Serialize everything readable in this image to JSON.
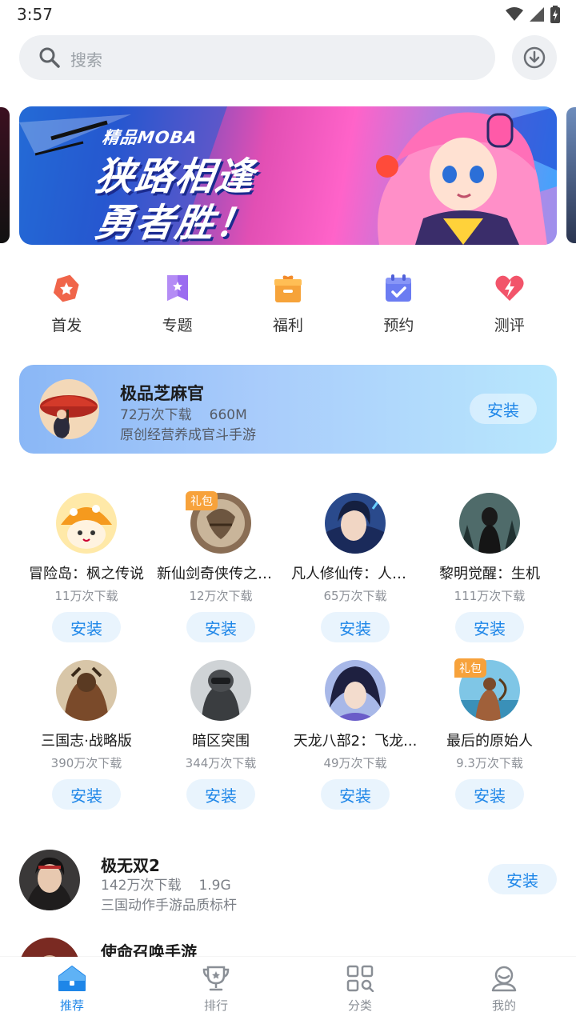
{
  "status_bar": {
    "time": "3:57"
  },
  "search": {
    "placeholder": "搜索"
  },
  "banner": {
    "tag": "精品MOBA",
    "line1": "狭路相逢",
    "line2": "勇者胜！"
  },
  "quick_nav": [
    {
      "label": "首发",
      "icon": "star-badge-icon",
      "color": "#f0654a"
    },
    {
      "label": "专题",
      "icon": "bookmark-icon",
      "color": "#9b6cf0"
    },
    {
      "label": "福利",
      "icon": "gift-box-icon",
      "color": "#f6a33a"
    },
    {
      "label": "预约",
      "icon": "calendar-check-icon",
      "color": "#6b7cf2"
    },
    {
      "label": "测评",
      "icon": "heart-bolt-icon",
      "color": "#f2546a"
    }
  ],
  "featured": {
    "title": "极品芝麻官",
    "downloads": "72万次下载",
    "size": "660M",
    "desc": "原创经营养成官斗手游",
    "install": "安装"
  },
  "grid": [
    {
      "name": "冒险岛：枫之传说",
      "downloads": "11万次下载",
      "install": "安装",
      "gift": ""
    },
    {
      "name": "新仙剑奇侠传之挥...",
      "downloads": "12万次下载",
      "install": "安装",
      "gift": "礼包"
    },
    {
      "name": "凡人修仙传：人界篇",
      "downloads": "65万次下载",
      "install": "安装",
      "gift": ""
    },
    {
      "name": "黎明觉醒：生机",
      "downloads": "111万次下载",
      "install": "安装",
      "gift": ""
    },
    {
      "name": "三国志·战略版",
      "downloads": "390万次下载",
      "install": "安装",
      "gift": ""
    },
    {
      "name": "暗区突围",
      "downloads": "344万次下载",
      "install": "安装",
      "gift": ""
    },
    {
      "name": "天龙八部2：飞龙...",
      "downloads": "49万次下载",
      "install": "安装",
      "gift": ""
    },
    {
      "name": "最后的原始人",
      "downloads": "9.3万次下载",
      "install": "安装",
      "gift": "礼包"
    }
  ],
  "list": [
    {
      "title": "极无双2",
      "downloads": "142万次下载",
      "size": "1.9G",
      "desc": "三国动作手游品质标杆",
      "install": "安装"
    },
    {
      "title": "使命召唤手游",
      "downloads": "",
      "size": "",
      "desc": "",
      "install": ""
    }
  ],
  "bottom_nav": [
    {
      "label": "推荐",
      "icon": "home-icon",
      "active": true
    },
    {
      "label": "排行",
      "icon": "trophy-icon",
      "active": false
    },
    {
      "label": "分类",
      "icon": "category-grid-icon",
      "active": false
    },
    {
      "label": "我的",
      "icon": "profile-icon",
      "active": false
    }
  ],
  "colors": {
    "accent": "#1e86e8",
    "install_bg": "#e9f4fd",
    "gift": "#f7a23b"
  }
}
